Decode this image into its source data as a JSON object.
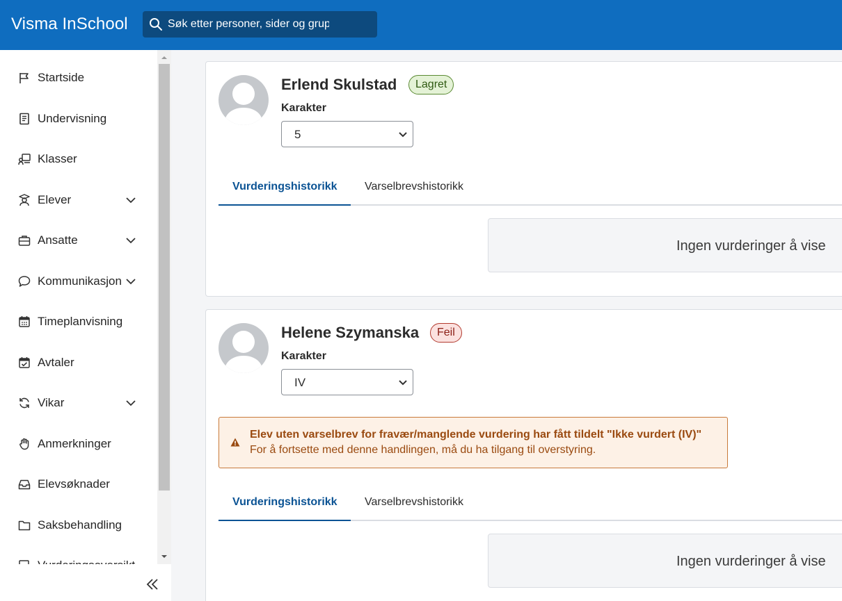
{
  "app": {
    "title": "Visma InSchool"
  },
  "search": {
    "placeholder": "Søk etter personer, sider og grupper"
  },
  "sidebar": {
    "items": [
      {
        "label": "Startside",
        "icon": "flag-icon",
        "expandable": false
      },
      {
        "label": "Undervisning",
        "icon": "book-icon",
        "expandable": false
      },
      {
        "label": "Klasser",
        "icon": "classroom-icon",
        "expandable": false
      },
      {
        "label": "Elever",
        "icon": "student-icon",
        "expandable": true
      },
      {
        "label": "Ansatte",
        "icon": "briefcase-icon",
        "expandable": true
      },
      {
        "label": "Kommunikasjon",
        "icon": "chat-icon",
        "expandable": true
      },
      {
        "label": "Timeplanvisning",
        "icon": "calendar-icon",
        "expandable": false
      },
      {
        "label": "Avtaler",
        "icon": "calendar-check-icon",
        "expandable": false
      },
      {
        "label": "Vikar",
        "icon": "refresh-icon",
        "expandable": true
      },
      {
        "label": "Anmerkninger",
        "icon": "hand-icon",
        "expandable": false
      },
      {
        "label": "Elevsøknader",
        "icon": "inbox-icon",
        "expandable": false
      },
      {
        "label": "Saksbehandling",
        "icon": "folder-icon",
        "expandable": false
      },
      {
        "label": "Vurderingsoversikt",
        "icon": "document-icon",
        "expandable": false
      }
    ]
  },
  "students": [
    {
      "name": "Erlend Skulstad",
      "status": "Lagret",
      "status_type": "success",
      "grade_label": "Karakter",
      "grade_value": "5",
      "tabs": [
        "Vurderingshistorikk",
        "Varselbrevshistorikk"
      ],
      "empty_text": "Ingen vurderinger å vise"
    },
    {
      "name": "Helene Szymanska",
      "status": "Feil",
      "status_type": "error",
      "grade_label": "Karakter",
      "grade_value": "IV",
      "warning": {
        "title": "Elev uten varselbrev for fravær/manglende vurdering har fått tildelt \"Ikke vurdert (IV)\"",
        "text": "For å fortsette med denne handlingen, må du ha tilgang til overstyring."
      },
      "tabs": [
        "Vurderingshistorikk",
        "Varselbrevshistorikk"
      ],
      "empty_text": "Ingen vurderinger å vise"
    }
  ],
  "colors": {
    "header": "#0f6dbf",
    "search_bg": "#0d4a7e",
    "active_tab": "#0b5394",
    "badge_success_bg": "#e4f2d6",
    "badge_error_bg": "#fbe1df",
    "warning_bg": "#fdf1e6",
    "warning_text": "#9a4a10"
  }
}
